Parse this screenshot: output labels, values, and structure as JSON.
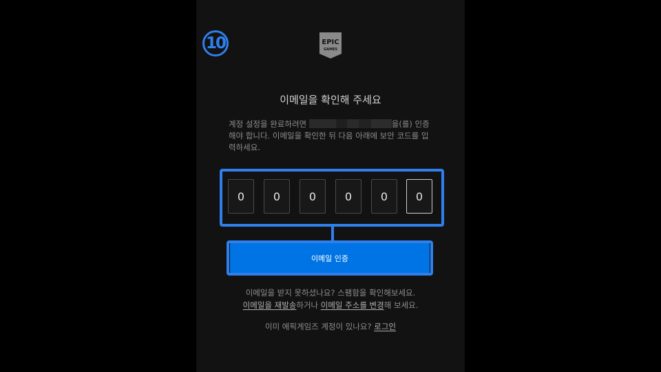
{
  "step_badge": "10",
  "logo": {
    "line1": "EPIC",
    "line2": "GAMES"
  },
  "title": "이메일을 확인해 주세요",
  "description": {
    "part1": "계정 설정을 완료하려면 ",
    "part2": "을(를) 인증해야 합니다. 이메일을 확인한 뒤 다음 아래에 보안 코드를 입력하세요."
  },
  "code_digits": [
    "0",
    "0",
    "0",
    "0",
    "0",
    "0"
  ],
  "verify_button": "이메일 인증",
  "help": {
    "line1": "이메일을 받지 못하셨나요? 스팸함을 확인해보세요.",
    "resend_link": "이메일을 재발송",
    "mid": "하거나 ",
    "change_link": "이메일 주소를 변경",
    "end": "해 보세요."
  },
  "login": {
    "prompt": "이미 에픽게임즈 계정이 있나요? ",
    "link": "로그인"
  },
  "colors": {
    "accent": "#2f80ed",
    "button": "#0074e4",
    "panel": "#121212"
  }
}
